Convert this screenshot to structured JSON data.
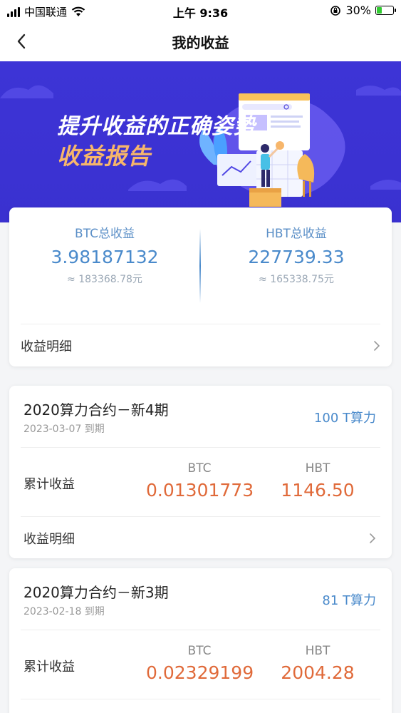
{
  "status_bar": {
    "carrier": "中国联通",
    "time": "上午 9:36",
    "battery": "30%",
    "battery_level": 0.3
  },
  "nav": {
    "title": "我的收益",
    "back_icon": "chevron-left-icon"
  },
  "banner": {
    "line1": "提升收益的正确姿势",
    "line2": "收益报告"
  },
  "summary": {
    "btc": {
      "label": "BTC总收益",
      "value": "3.98187132",
      "sub": "≈ 183368.78元"
    },
    "hbt": {
      "label": "HBT总收益",
      "value": "227739.33",
      "sub": "≈ 165338.75元"
    },
    "detail_label": "收益明细"
  },
  "contracts": [
    {
      "title": "2020算力合约－新4期",
      "date": "2023-03-07 到期",
      "power": "100 T算力",
      "cum_label": "累计收益",
      "btc_label": "BTC",
      "btc_value": "0.01301773",
      "hbt_label": "HBT",
      "hbt_value": "1146.50",
      "detail_label": "收益明细"
    },
    {
      "title": "2020算力合约－新3期",
      "date": "2023-02-18 到期",
      "power": "81 T算力",
      "cum_label": "累计收益",
      "btc_label": "BTC",
      "btc_value": "0.02329199",
      "hbt_label": "HBT",
      "hbt_value": "2004.28"
    }
  ],
  "colors": {
    "banner_bg": "#3d34d6",
    "accent_blue": "#4a8acb",
    "earning_orange": "#e06a3a",
    "banner_gold": "#f7b66b"
  }
}
